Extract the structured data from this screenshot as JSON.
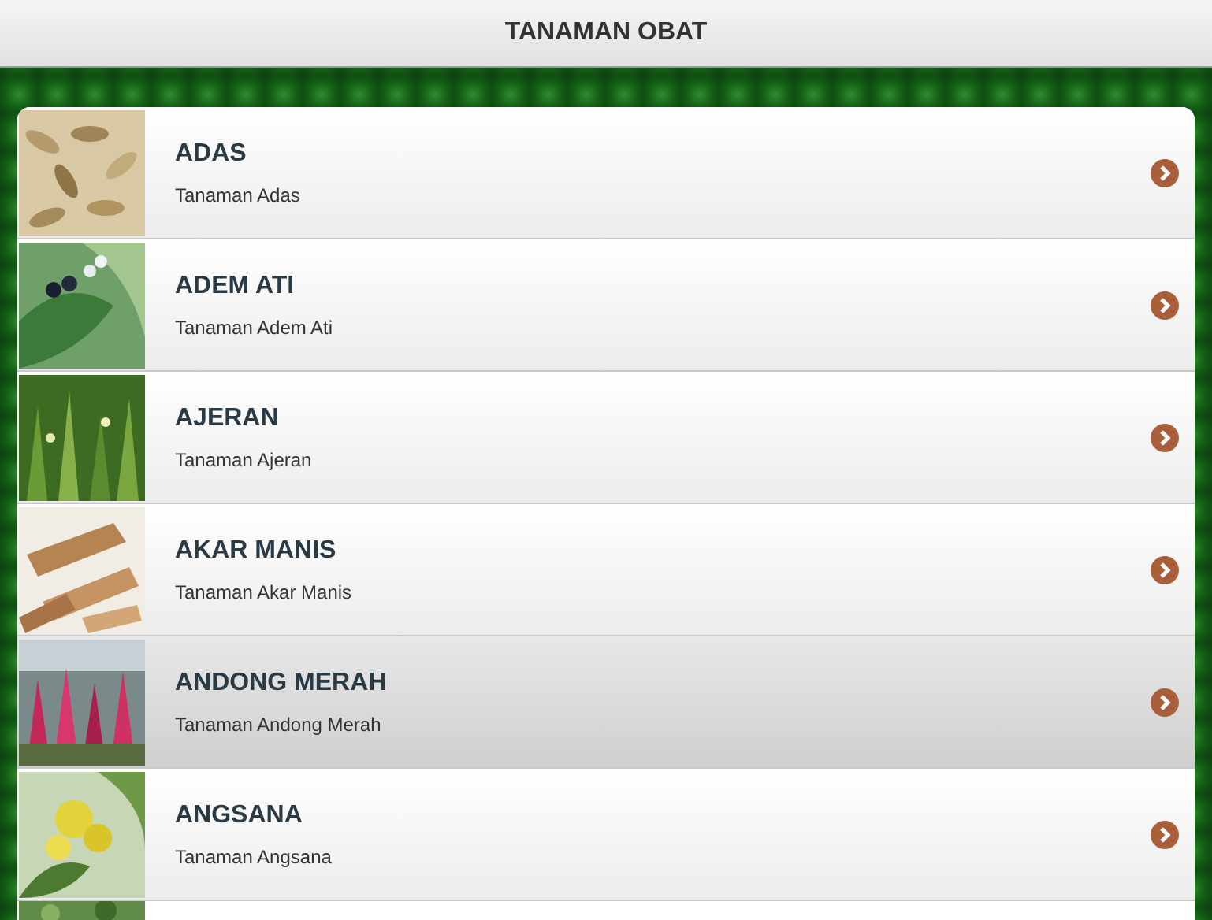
{
  "header": {
    "title": "TANAMAN OBAT"
  },
  "items": [
    {
      "name": "ADAS",
      "subtitle": "Tanaman Adas",
      "selected": false
    },
    {
      "name": "ADEM ATI",
      "subtitle": "Tanaman Adem Ati",
      "selected": false
    },
    {
      "name": "AJERAN",
      "subtitle": "Tanaman Ajeran",
      "selected": false
    },
    {
      "name": "AKAR MANIS",
      "subtitle": "Tanaman Akar Manis",
      "selected": false
    },
    {
      "name": "ANDONG MERAH",
      "subtitle": "Tanaman Andong Merah",
      "selected": true
    },
    {
      "name": "ANGSANA",
      "subtitle": "Tanaman Angsana",
      "selected": false
    }
  ]
}
